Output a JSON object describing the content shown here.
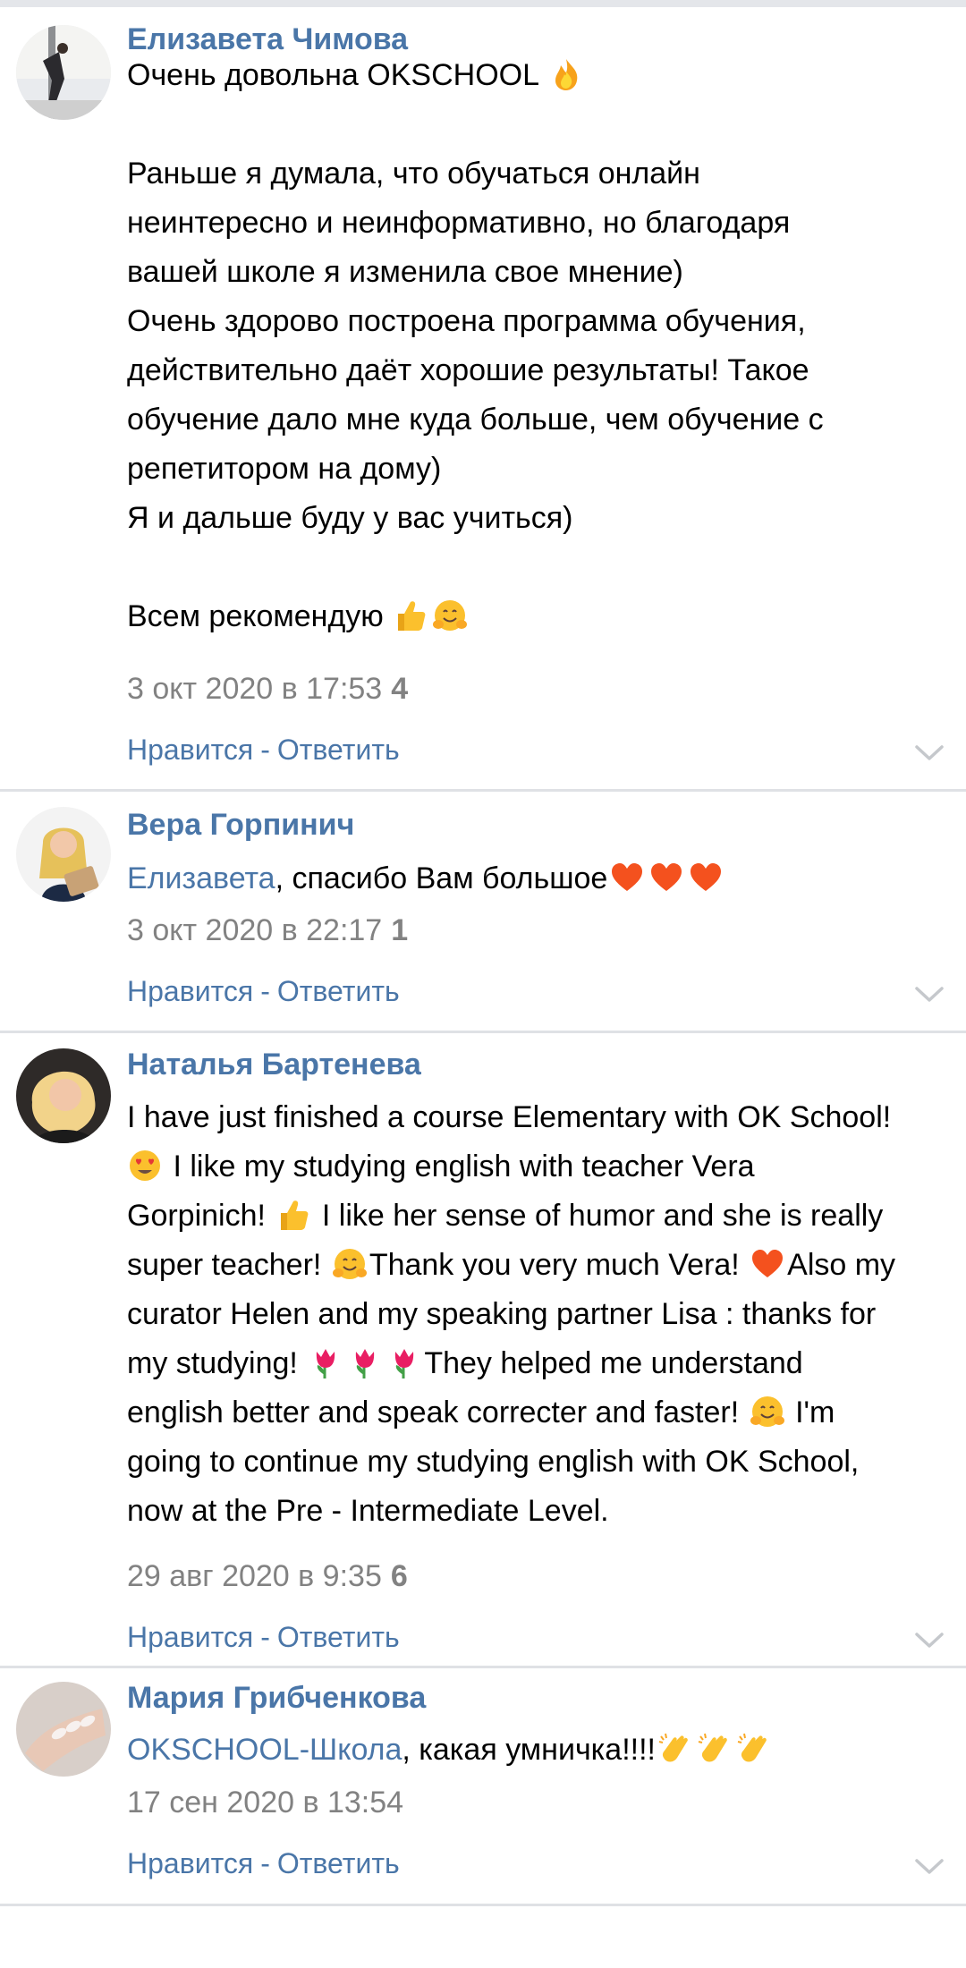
{
  "comments": [
    {
      "author": "Елизавета Чимова",
      "lines": [
        "Очень довольна OKSCHOOL",
        "",
        "Раньше я думала, что обучаться онлайн",
        "неинтересно и неинформативно, но благодаря",
        "вашей школе я изменила свое мнение)",
        "Очень здорово построена программа обучения,",
        "действительно даёт хорошие результаты! Такое",
        "обучение дало мне куда больше, чем обучение с",
        "репетитором на дому)",
        "Я и дальше буду у вас учиться)",
        "",
        "Всем рекомендую"
      ],
      "date": "3 окт 2020 в 17:53",
      "likes": "4",
      "like_label": "Нравится",
      "separator": "-",
      "reply_label": "Ответить"
    },
    {
      "author": "Вера Горпинич",
      "mention": "Елизавета",
      "text": ", спасибо Вам большое",
      "date": "3 окт 2020 в 22:17",
      "likes": "1",
      "like_label": "Нравится",
      "separator": "-",
      "reply_label": "Ответить"
    },
    {
      "author": "Наталья Бартенева",
      "segments": [
        "I have just finished a course Elementary with OK School!",
        "I like my studying english with teacher Vera",
        "Gorpinich!",
        "I like her sense of humor and she is really",
        "super teacher!",
        "Thank you very much Vera!",
        "Also my",
        "curator Helen and my speaking partner Lisa : thanks for",
        "my studying!",
        "They helped me understand",
        "english better and speak correcter and faster!",
        "I'm",
        "going to continue my studying english with OK School,",
        "now at the Pre - Intermediate Level."
      ],
      "date": "29 авг 2020 в 9:35",
      "likes": "6",
      "like_label": "Нравится",
      "separator": "-",
      "reply_label": "Ответить"
    },
    {
      "author": "Мария Грибченкова",
      "mention": "OKSCHOOL-Школа",
      "text": ", какая умничка!!!!",
      "date": "17 сен 2020 в 13:54",
      "like_label": "Нравится",
      "separator": "-",
      "reply_label": "Ответить"
    }
  ],
  "icons": {
    "avatar": "avatar-photo",
    "chevron": "chevron-down-icon",
    "emoji": [
      "fire",
      "thumbs-up",
      "hugging-face",
      "orange-heart",
      "heart-eyes",
      "tulip",
      "clapping-hands"
    ]
  },
  "colors": {
    "link": "#4a76a8",
    "meta": "#828282",
    "divider": "#dfe1e5"
  }
}
